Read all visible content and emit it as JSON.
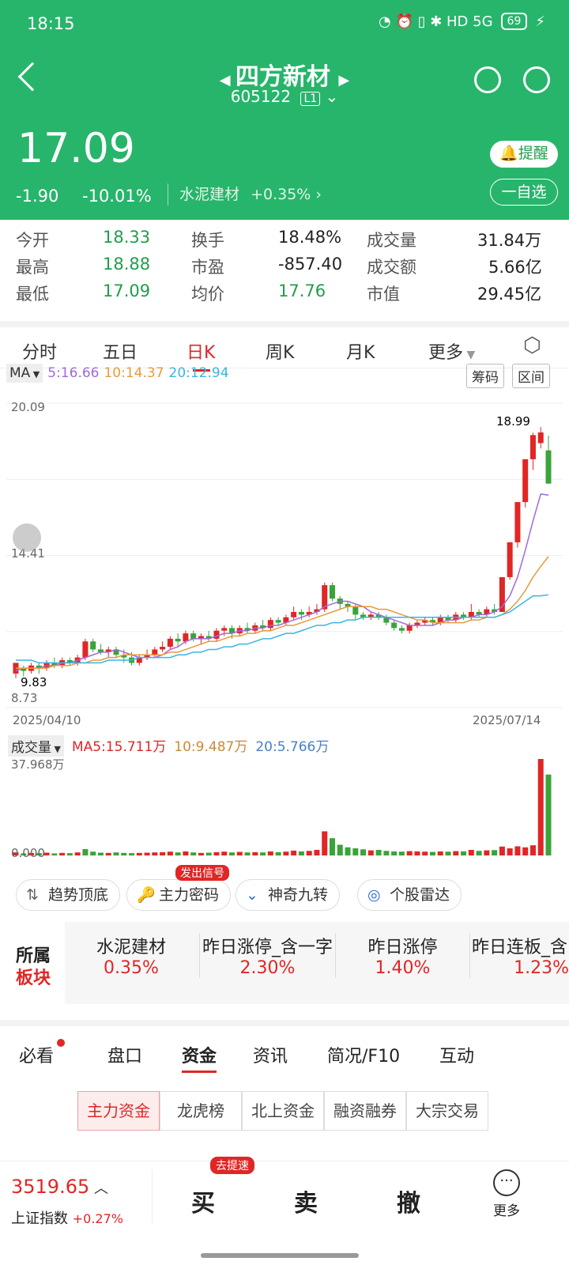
{
  "status": {
    "time": "18:15",
    "battery": "69",
    "right_icons": "◔ ⏰ ▯ ✱ HD 5G"
  },
  "header": {
    "title": "四方新材",
    "code": "605122",
    "level": "L1",
    "price": "17.09",
    "change": "-1.90",
    "change_pct": "-10.01%",
    "sector": "水泥建材",
    "sector_pct": "+0.35%",
    "alert_label": "提醒",
    "watch_label": "一自选"
  },
  "quote": [
    {
      "label": "今开",
      "value": "18.33"
    },
    {
      "label": "换手",
      "value": "18.48%"
    },
    {
      "label": "成交量",
      "value": "31.84万"
    },
    {
      "label": "最高",
      "value": "18.88"
    },
    {
      "label": "市盈",
      "value": "-857.40"
    },
    {
      "label": "成交额",
      "value": "5.66亿"
    },
    {
      "label": "最低",
      "value": "17.09"
    },
    {
      "label": "均价",
      "value": "17.76"
    },
    {
      "label": "市值",
      "value": "29.45亿"
    }
  ],
  "tabs": [
    "分时",
    "五日",
    "日K",
    "周K",
    "月K",
    "更多"
  ],
  "ma": {
    "label": "MA",
    "ma5": "5:16.66",
    "ma10": "10:14.37",
    "ma20": "20:12.94"
  },
  "chart_buttons": [
    "筹码",
    "区间"
  ],
  "chart_data": {
    "type": "candlestick",
    "ymax_label": "20.09",
    "ymid_label": "14.41",
    "ymin_label": "8.73",
    "low_marker": "9.83",
    "high_marker": "18.99",
    "start_date": "2025/04/10",
    "end_date": "2025/07/14",
    "ylim": [
      8.73,
      20.09
    ],
    "candles": [
      [
        10.0,
        10.4,
        9.83,
        10.2
      ],
      [
        10.2,
        10.1,
        9.9,
        10.3
      ],
      [
        10.1,
        10.3,
        10.0,
        10.4
      ],
      [
        10.3,
        10.2,
        10.0,
        10.4
      ],
      [
        10.2,
        10.4,
        10.1,
        10.5
      ],
      [
        10.4,
        10.3,
        10.2,
        10.6
      ],
      [
        10.3,
        10.5,
        10.2,
        10.6
      ],
      [
        10.5,
        10.4,
        10.3,
        10.6
      ],
      [
        10.4,
        10.6,
        10.3,
        10.7
      ],
      [
        10.6,
        11.2,
        10.5,
        11.3
      ],
      [
        11.2,
        10.9,
        10.8,
        11.3
      ],
      [
        10.9,
        10.8,
        10.7,
        11.1
      ],
      [
        10.8,
        10.9,
        10.6,
        11.0
      ],
      [
        10.9,
        10.7,
        10.6,
        11.0
      ],
      [
        10.7,
        10.6,
        10.4,
        10.9
      ],
      [
        10.6,
        10.4,
        10.3,
        10.8
      ],
      [
        10.4,
        10.6,
        10.3,
        10.7
      ],
      [
        10.6,
        10.7,
        10.5,
        10.9
      ],
      [
        10.7,
        10.9,
        10.6,
        11.0
      ],
      [
        10.9,
        11.0,
        10.8,
        11.2
      ],
      [
        11.0,
        11.3,
        10.9,
        11.4
      ],
      [
        11.3,
        11.2,
        11.0,
        11.5
      ],
      [
        11.2,
        11.5,
        11.1,
        11.6
      ],
      [
        11.5,
        11.3,
        11.2,
        11.6
      ],
      [
        11.3,
        11.4,
        11.1,
        11.5
      ],
      [
        11.4,
        11.3,
        11.2,
        11.6
      ],
      [
        11.3,
        11.6,
        11.2,
        11.7
      ],
      [
        11.6,
        11.7,
        11.4,
        11.8
      ],
      [
        11.7,
        11.5,
        11.3,
        11.8
      ],
      [
        11.5,
        11.7,
        11.4,
        11.8
      ],
      [
        11.7,
        11.6,
        11.5,
        11.9
      ],
      [
        11.6,
        11.8,
        11.5,
        11.9
      ],
      [
        11.8,
        11.7,
        11.6,
        12.0
      ],
      [
        11.7,
        12.0,
        11.6,
        12.1
      ],
      [
        12.0,
        11.9,
        11.8,
        12.1
      ],
      [
        11.9,
        12.1,
        11.8,
        12.2
      ],
      [
        12.1,
        12.3,
        12.0,
        12.5
      ],
      [
        12.3,
        12.2,
        12.0,
        12.4
      ],
      [
        12.2,
        12.3,
        12.1,
        12.5
      ],
      [
        12.3,
        12.4,
        12.2,
        12.6
      ],
      [
        12.4,
        13.3,
        12.3,
        13.4
      ],
      [
        13.3,
        12.8,
        12.7,
        13.4
      ],
      [
        12.8,
        12.6,
        12.4,
        12.9
      ],
      [
        12.6,
        12.5,
        12.3,
        12.7
      ],
      [
        12.5,
        12.2,
        12.0,
        12.6
      ],
      [
        12.2,
        12.1,
        12.0,
        12.3
      ],
      [
        12.1,
        12.2,
        12.0,
        12.3
      ],
      [
        12.2,
        12.1,
        12.0,
        12.3
      ],
      [
        12.1,
        11.9,
        11.8,
        12.2
      ],
      [
        11.9,
        11.7,
        11.6,
        12.0
      ],
      [
        11.7,
        11.6,
        11.5,
        11.8
      ],
      [
        11.6,
        11.8,
        11.5,
        11.9
      ],
      [
        11.8,
        11.9,
        11.7,
        12.0
      ],
      [
        11.9,
        12.0,
        11.8,
        12.1
      ],
      [
        12.0,
        11.9,
        11.8,
        12.1
      ],
      [
        11.9,
        12.1,
        11.8,
        12.2
      ],
      [
        12.1,
        12.0,
        11.9,
        12.2
      ],
      [
        12.0,
        12.2,
        11.9,
        12.3
      ],
      [
        12.2,
        12.1,
        12.0,
        12.3
      ],
      [
        12.1,
        12.3,
        12.0,
        12.6
      ],
      [
        12.3,
        12.2,
        12.1,
        12.4
      ],
      [
        12.2,
        12.4,
        12.1,
        12.5
      ],
      [
        12.4,
        12.3,
        12.2,
        12.6
      ],
      [
        12.3,
        13.6,
        12.3,
        13.6
      ],
      [
        13.6,
        14.9,
        13.5,
        14.9
      ],
      [
        14.9,
        16.4,
        14.7,
        16.4
      ],
      [
        16.4,
        18.0,
        16.2,
        18.0
      ],
      [
        18.0,
        18.9,
        17.6,
        18.99
      ],
      [
        18.6,
        19.0,
        18.4,
        19.2
      ],
      [
        18.33,
        17.09,
        17.09,
        18.88
      ]
    ],
    "ma5": [
      10.1,
      10.2,
      10.2,
      10.2,
      10.3,
      10.3,
      10.4,
      10.4,
      10.5,
      10.6,
      10.7,
      10.8,
      10.8,
      10.9,
      10.8,
      10.7,
      10.6,
      10.6,
      10.6,
      10.7,
      10.9,
      11.0,
      11.2,
      11.3,
      11.3,
      11.3,
      11.4,
      11.5,
      11.5,
      11.6,
      11.6,
      11.7,
      11.7,
      11.8,
      11.8,
      11.9,
      12.0,
      12.1,
      12.2,
      12.3,
      12.5,
      12.6,
      12.7,
      12.7,
      12.6,
      12.5,
      12.3,
      12.2,
      12.1,
      12.0,
      11.9,
      11.8,
      11.8,
      11.8,
      11.8,
      11.9,
      12.0,
      12.0,
      12.1,
      12.1,
      12.2,
      12.2,
      12.3,
      12.5,
      12.9,
      13.6,
      14.6,
      15.7,
      16.7,
      16.66
    ],
    "ma10": [
      10.2,
      10.2,
      10.2,
      10.2,
      10.2,
      10.3,
      10.3,
      10.3,
      10.4,
      10.4,
      10.5,
      10.5,
      10.6,
      10.6,
      10.7,
      10.7,
      10.7,
      10.7,
      10.7,
      10.7,
      10.8,
      10.8,
      10.9,
      11.0,
      11.1,
      11.2,
      11.2,
      11.3,
      11.4,
      11.4,
      11.5,
      11.5,
      11.6,
      11.6,
      11.7,
      11.8,
      11.8,
      11.9,
      12.0,
      12.1,
      12.2,
      12.3,
      12.4,
      12.5,
      12.5,
      12.5,
      12.5,
      12.4,
      12.4,
      12.3,
      12.2,
      12.1,
      12.0,
      12.0,
      11.9,
      11.9,
      11.9,
      11.9,
      11.9,
      12.0,
      12.0,
      12.1,
      12.1,
      12.2,
      12.4,
      12.7,
      13.1,
      13.6,
      14.0,
      14.37
    ],
    "ma20": [
      10.5,
      10.5,
      10.5,
      10.4,
      10.4,
      10.4,
      10.4,
      10.4,
      10.4,
      10.4,
      10.4,
      10.4,
      10.5,
      10.5,
      10.5,
      10.5,
      10.6,
      10.6,
      10.6,
      10.6,
      10.6,
      10.7,
      10.7,
      10.8,
      10.8,
      10.9,
      10.9,
      11.0,
      11.0,
      11.1,
      11.1,
      11.2,
      11.3,
      11.3,
      11.4,
      11.5,
      11.5,
      11.6,
      11.7,
      11.8,
      11.8,
      11.9,
      11.9,
      12.0,
      12.0,
      12.1,
      12.1,
      12.1,
      12.1,
      12.1,
      12.1,
      12.1,
      12.1,
      12.1,
      12.1,
      12.1,
      12.1,
      12.1,
      12.1,
      12.1,
      12.1,
      12.1,
      12.1,
      12.2,
      12.3,
      12.5,
      12.7,
      12.9,
      12.9,
      12.94
    ]
  },
  "volume": {
    "label": "成交量",
    "ma5": "MA5:15.711万",
    "ma10": "10:9.487万",
    "ma20": "20:5.766万",
    "max_label": "37.968万",
    "min_label": "0.000",
    "values": [
      1.2,
      0.8,
      1.0,
      0.9,
      1.1,
      0.8,
      1.0,
      0.9,
      1.2,
      2.5,
      1.5,
      1.1,
      1.0,
      1.2,
      1.0,
      0.9,
      1.0,
      1.1,
      1.2,
      1.3,
      1.5,
      1.2,
      1.6,
      1.2,
      1.0,
      1.1,
      1.3,
      1.5,
      1.2,
      1.4,
      1.2,
      1.3,
      1.2,
      1.6,
      1.3,
      1.5,
      1.9,
      1.6,
      1.8,
      2.2,
      9.5,
      6.8,
      4.2,
      3.2,
      2.8,
      2.4,
      2.0,
      2.2,
      1.8,
      1.6,
      1.5,
      1.7,
      1.6,
      1.5,
      1.4,
      1.6,
      1.5,
      1.7,
      1.6,
      2.2,
      1.8,
      2.0,
      2.1,
      3.5,
      2.8,
      3.6,
      3.2,
      4.0,
      37.968,
      31.84
    ],
    "up": [
      true,
      false,
      true,
      false,
      true,
      false,
      true,
      false,
      true,
      false,
      false,
      false,
      true,
      false,
      false,
      false,
      true,
      true,
      true,
      true,
      true,
      false,
      true,
      false,
      true,
      false,
      true,
      true,
      false,
      true,
      false,
      true,
      false,
      true,
      false,
      true,
      true,
      false,
      true,
      true,
      true,
      false,
      false,
      false,
      false,
      false,
      true,
      false,
      false,
      false,
      false,
      true,
      true,
      true,
      false,
      true,
      false,
      true,
      false,
      true,
      false,
      true,
      false,
      true,
      true,
      true,
      true,
      true,
      true,
      false
    ]
  },
  "tools": [
    "趋势顶底",
    "主力密码",
    "神奇九转",
    "个股雷达"
  ],
  "tool_badge": "发出信号",
  "board": {
    "title1": "所属",
    "title2": "板块",
    "items": [
      {
        "name": "水泥建材",
        "pct": "0.35%"
      },
      {
        "name": "昨日涨停_含一字",
        "pct": "2.30%"
      },
      {
        "name": "昨日涨停",
        "pct": "1.40%"
      },
      {
        "name": "昨日连板_含",
        "pct": "1.23%"
      }
    ]
  },
  "info_tabs": [
    "必看",
    "盘口",
    "资金",
    "资讯",
    "简况/F10",
    "互动"
  ],
  "sub_tabs": [
    "主力资金",
    "龙虎榜",
    "北上资金",
    "融资融券",
    "大宗交易"
  ],
  "bottom": {
    "index_value": "3519.65",
    "index_name": "上证指数",
    "index_pct": "+0.27%",
    "buy": "买",
    "buy_badge": "去提速",
    "sell": "卖",
    "cancel": "撤",
    "more": "更多"
  }
}
